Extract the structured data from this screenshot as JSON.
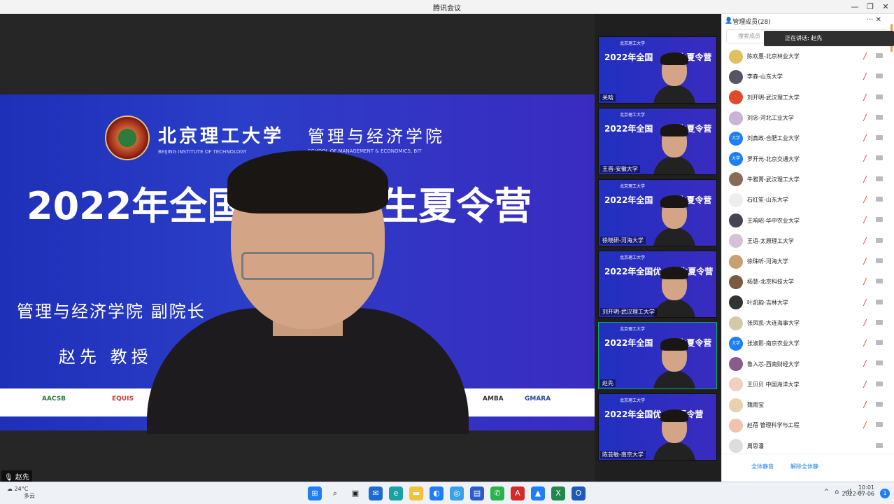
{
  "window": {
    "title": "腾讯会议"
  },
  "slide": {
    "school_cn": "北京理工大学",
    "school_en": "BEIJING INSTITUTE OF TECHNOLOGY",
    "school2_cn": "管理与经济学院",
    "school2_en": "SCHOOL OF MANAGEMENT & ECONOMICS, BIT",
    "camp_title": "2022年全国",
    "camp_title_rest": "学生夏令营",
    "deputy": "管理与经济学院  副院长",
    "name_line": "赵先    教授",
    "sponsors": [
      "AACSB",
      "EQUIS",
      "AMBA",
      "GMARA"
    ]
  },
  "speaker": {
    "name": "赵先"
  },
  "thumbnails": [
    {
      "title": "2022年全国",
      "title_rest": "学生夏令营",
      "name": "关晗"
    },
    {
      "title": "2022年全国",
      "title_rest": "学生夏令营",
      "name": "王晋-安徽大学"
    },
    {
      "title": "2022年全国",
      "title_rest": "学生夏令营",
      "name": "徐晓研-河海大学"
    },
    {
      "title": "2022年全国优",
      "title_rest": "学生夏令营",
      "name": "刘开明-武汉理工大学"
    },
    {
      "title": "2022年全国",
      "title_rest": "学生夏令营",
      "name": "赵先"
    },
    {
      "title": "2022年全国优",
      "title_rest": "夏令营",
      "name": "陈芸敏-南京大学"
    }
  ],
  "panel": {
    "header": "管理成员(28)",
    "search_placeholder": "搜索成员",
    "toast": "正在讲话: 赵先",
    "members": [
      "陈欢惠-北京林业大学",
      "李森-山东大学",
      "刘开明-武汉理工大学",
      "刘念-河北工业大学",
      "刘真政-合肥工业大学",
      "罗开元-北京交通大学",
      "牛雅菁-武汉理工大学",
      "石红笙-山东大学",
      "王响昭-华中农业大学",
      "王语-太原理工大学",
      "徐珠听-河海大学",
      "杨慧-北京科技大学",
      "叶凯韵-吉林大学",
      "张凤凯-大连海事大学",
      "张淑影-南京农业大学",
      "鲁入芯-西南财经大学",
      "王贝贝 中国海洋大学",
      "魏雨宝",
      "赵蓓 管理科学与工程",
      "周思潘"
    ],
    "blue_avatar_text": "大学",
    "mute_all": "全体静音",
    "unmute_all": "解除全体静"
  },
  "taskbar": {
    "temp": "24°C",
    "weather": "多云",
    "time": "10:01",
    "date": "2022-07-06"
  }
}
